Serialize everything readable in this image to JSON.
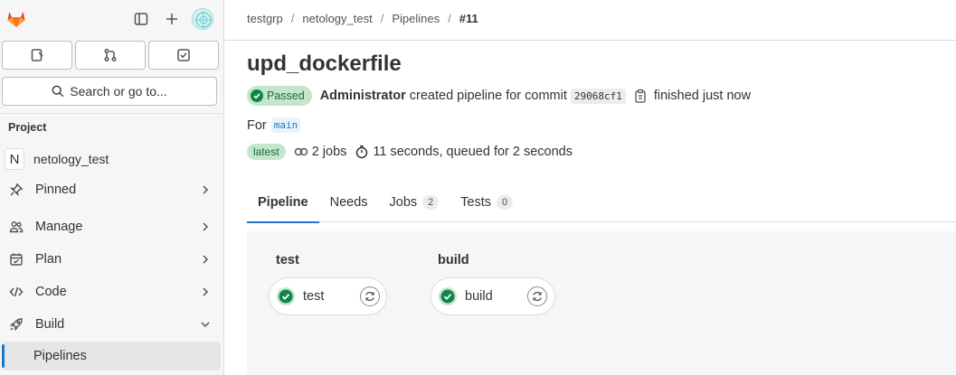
{
  "sidebar": {
    "search_label": "Search or go to...",
    "section_title": "Project",
    "project": {
      "initial": "N",
      "name": "netology_test"
    },
    "items": [
      {
        "label": "Pinned",
        "icon": "pin-icon"
      },
      {
        "label": "Manage",
        "icon": "users-icon"
      },
      {
        "label": "Plan",
        "icon": "calendar-icon"
      },
      {
        "label": "Code",
        "icon": "code-icon"
      },
      {
        "label": "Build",
        "icon": "rocket-icon"
      }
    ],
    "sub_item": "Pipelines"
  },
  "breadcrumb": [
    "testgrp",
    "netology_test",
    "Pipelines",
    "#11"
  ],
  "pipeline": {
    "title": "upd_dockerfile",
    "status": "Passed",
    "author": "Administrator",
    "action_text": "created pipeline for commit",
    "commit_sha": "29068cf1",
    "finished_text": "finished just now",
    "for_label": "For",
    "ref": "main",
    "tag": "latest",
    "jobs_text": "2 jobs",
    "duration_text": "11 seconds, queued for 2 seconds"
  },
  "tabs": [
    {
      "label": "Pipeline",
      "count": null
    },
    {
      "label": "Needs",
      "count": null
    },
    {
      "label": "Jobs",
      "count": "2"
    },
    {
      "label": "Tests",
      "count": "0"
    }
  ],
  "stages": [
    {
      "title": "test",
      "job": "test",
      "status": "success"
    },
    {
      "title": "build",
      "job": "build",
      "status": "success"
    }
  ],
  "colors": {
    "accent": "#1f75cb",
    "success": "#108548",
    "success_bg": "#c3e6cd",
    "sidebar_bg": "#f6f6f7"
  }
}
